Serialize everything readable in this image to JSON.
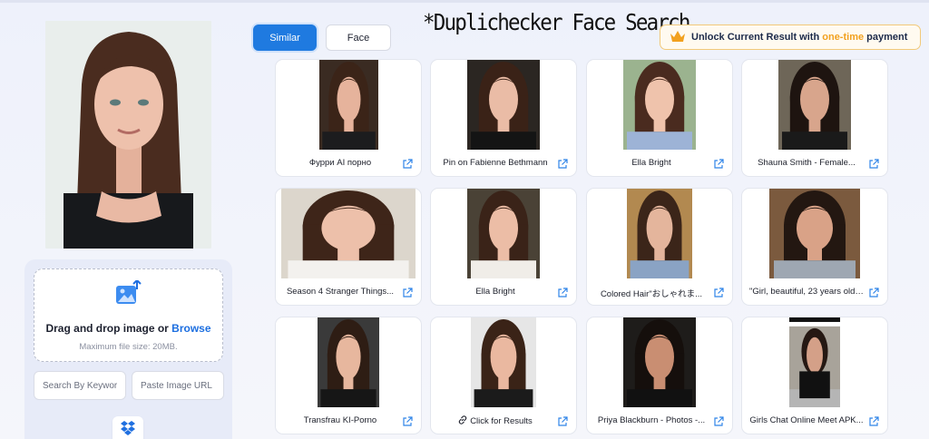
{
  "tabs": [
    {
      "label": "Similar",
      "active": true
    },
    {
      "label": "Face",
      "active": false
    }
  ],
  "title": "*Duplichecker Face Search",
  "unlock": {
    "prefix": "Unlock Current Result with ",
    "highlight": "one-time",
    "suffix": " payment",
    "icon": "crown-icon"
  },
  "upload": {
    "drop_text": "Drag and drop image or ",
    "browse": "Browse",
    "max_size": "Maximum file size: 20MB.",
    "keyword_placeholder": "Search By Keywor",
    "url_placeholder": "Paste Image URL",
    "dropbox_icon": "dropbox-icon"
  },
  "results": [
    {
      "caption": "Фурри AI порно"
    },
    {
      "caption": "Pin on Fabienne Bethmann"
    },
    {
      "caption": "Ella Bright"
    },
    {
      "caption": "Shauna Smith - Female..."
    },
    {
      "caption": "Season 4 Stranger Things..."
    },
    {
      "caption": "Ella Bright"
    },
    {
      "caption": "Colored Hair\"おしゃれま..."
    },
    {
      "caption": "\"Girl, beautiful, 23 years old,..."
    },
    {
      "caption": "Transfrau KI-Porno"
    },
    {
      "caption": "Click for Results",
      "link_icon": true
    },
    {
      "caption": "Priya Blackburn - Photos -..."
    },
    {
      "caption": "Girls Chat Online Meet APK..."
    }
  ],
  "colors": {
    "accent": "#1f7ae0",
    "gold": "#f2a11f",
    "link": "#1d6fe0"
  }
}
